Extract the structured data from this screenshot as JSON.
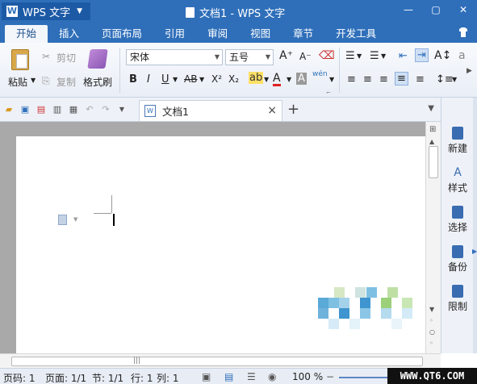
{
  "app": {
    "menu_label": "WPS 文字",
    "window_title": "文档1 - WPS 文字"
  },
  "window_controls": {
    "minimize": "—",
    "restore": "▢",
    "close": "✕"
  },
  "tabs": [
    "开始",
    "插入",
    "页面布局",
    "引用",
    "审阅",
    "视图",
    "章节",
    "开发工具"
  ],
  "ribbon": {
    "paste": "粘贴",
    "cut": "剪切",
    "copy": "复制",
    "format_painter": "格式刷",
    "font_name": "宋体",
    "font_size": "五号",
    "bold": "B",
    "italic": "I",
    "underline": "U",
    "strike": "AB",
    "superscript": "X²",
    "subscript": "X₂",
    "font_color": "A",
    "char_shading": "A",
    "phonetic": "wén",
    "grow_font": "A⁺",
    "shrink_font": "A⁻"
  },
  "document_tab": {
    "name": "文档1",
    "close": "×",
    "new": "+"
  },
  "task_pane": [
    "新建",
    "样式",
    "选择",
    "备份",
    "限制"
  ],
  "status_bar": {
    "page_num": "页码: 1",
    "pages": "页面: 1/1",
    "section": "节: 1/1",
    "row": "行: 1",
    "col": "列: 1",
    "zoom": "100 %"
  },
  "watermark": "WWW.QT6.COM",
  "colors": {
    "accent": "#2f6fba",
    "doc_bg": "#a9a9a9"
  }
}
